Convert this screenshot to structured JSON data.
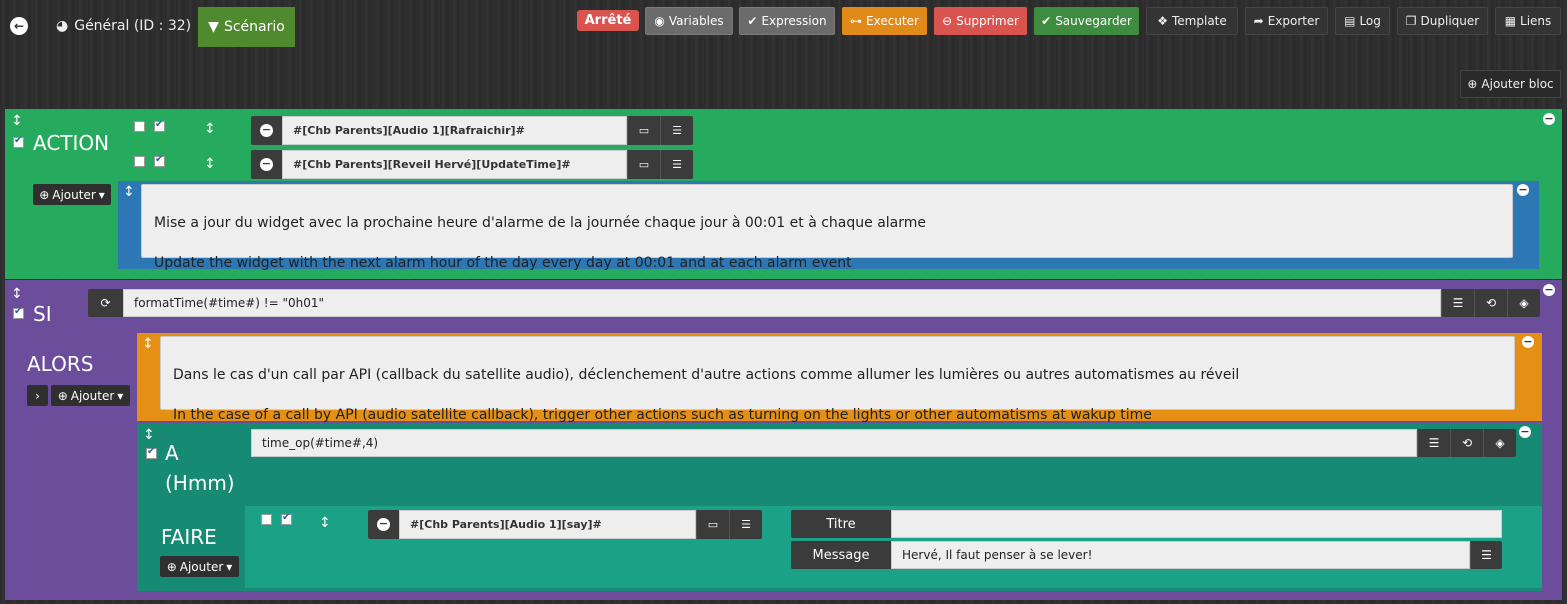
{
  "nav": {
    "general": "Général (ID : 32)",
    "scenario": "Scénario"
  },
  "toolbar": {
    "status": "Arrêté",
    "variables": "Variables",
    "expression": "Expression",
    "executer": "Executer",
    "supprimer": "Supprimer",
    "sauvegarder": "Sauvegarder",
    "template": "Template",
    "exporter": "Exporter",
    "log": "Log",
    "dupliquer": "Dupliquer",
    "liens": "Liens"
  },
  "add_bloc": "Ajouter bloc",
  "action_block": {
    "label": "ACTION",
    "ajouter": "Ajouter",
    "commands": [
      "#[Chb Parents][Audio 1][Rafraichir]#",
      "#[Chb Parents][Reveil Hervé][UpdateTime]#"
    ],
    "comment_lines": [
      "Mise a jour du widget avec la prochaine heure d'alarme de la journée chaque jour à 00:01 et à chaque alarme",
      "Update the widget with the next alarm hour of the day every day at 00:01 and at each alarm event"
    ]
  },
  "si_block": {
    "label": "SI",
    "condition": "formatTime(#time#) != \"0h01\"",
    "alors_label": "ALORS",
    "ajouter": "Ajouter",
    "comment_lines": [
      "Dans le cas d'un call par API (callback du satellite audio), déclenchement d'autre actions comme allumer les lumières ou autres automatismes au réveil",
      "In the case of a call by API (audio satellite callback), trigger other actions such as turning on the lights or other automatisms at wakup time"
    ],
    "a_block": {
      "label": "A",
      "sub_label": "(Hmm)",
      "expression": "time_op(#time#,4)",
      "faire_label": "FAIRE",
      "ajouter": "Ajouter",
      "command": "#[Chb Parents][Audio 1][say]#",
      "titre_label": "Titre",
      "titre_value": "",
      "message_label": "Message",
      "message_value": "Hervé, Il faut penser à se lever!"
    }
  }
}
